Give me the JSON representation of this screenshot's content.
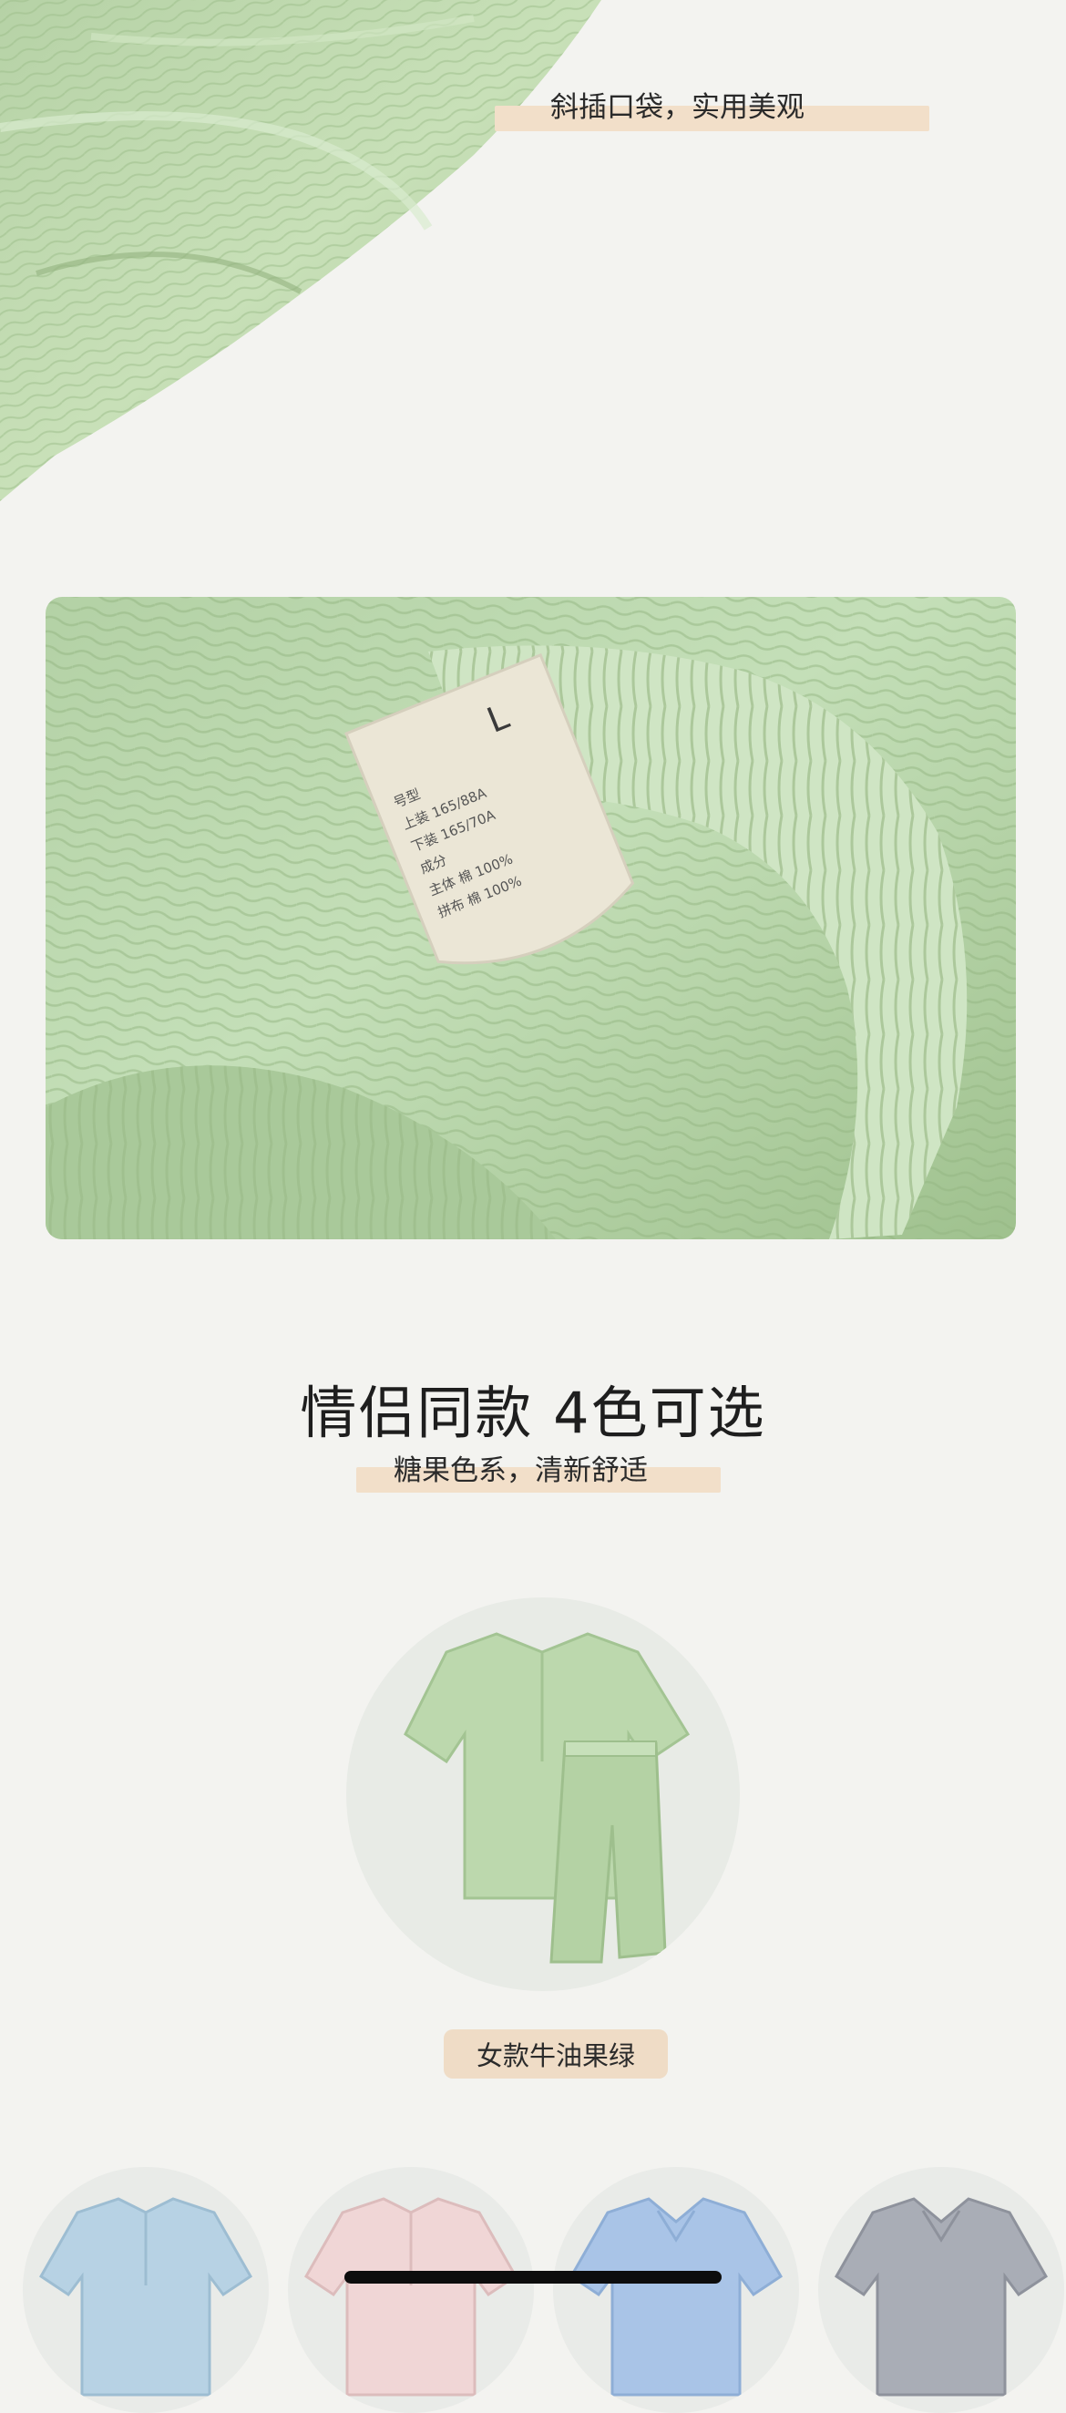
{
  "captions": {
    "pocket": "斜插口袋，实用美观",
    "colors_sub": "糖果色系，清新舒适"
  },
  "section": {
    "title": "情侣同款 4色可选"
  },
  "featured_variant": {
    "label": "女款牛油果绿"
  },
  "label_tag": {
    "size": "L",
    "lines": [
      "号型",
      "上装 165/88A",
      "下装 165/70A",
      "成分",
      "主体 棉 100%",
      "拼布 棉 100%"
    ]
  },
  "colors": {
    "background": "#f3f3f0",
    "accent_strip": "#f2dfc9",
    "sage_green": "#bcd8ad",
    "sky_blue": "#b7d2e4",
    "blush_pink": "#f0d6d6",
    "powder_blue": "#a9c4e7",
    "grey": "#a9adb6"
  },
  "variants_row": [
    {
      "color_name": "sky-blue",
      "icon": "pajama-set-icon"
    },
    {
      "color_name": "blush-pink",
      "icon": "pajama-set-icon"
    },
    {
      "color_name": "powder-blue",
      "icon": "pajama-set-icon"
    },
    {
      "color_name": "grey",
      "icon": "pajama-set-icon"
    }
  ]
}
